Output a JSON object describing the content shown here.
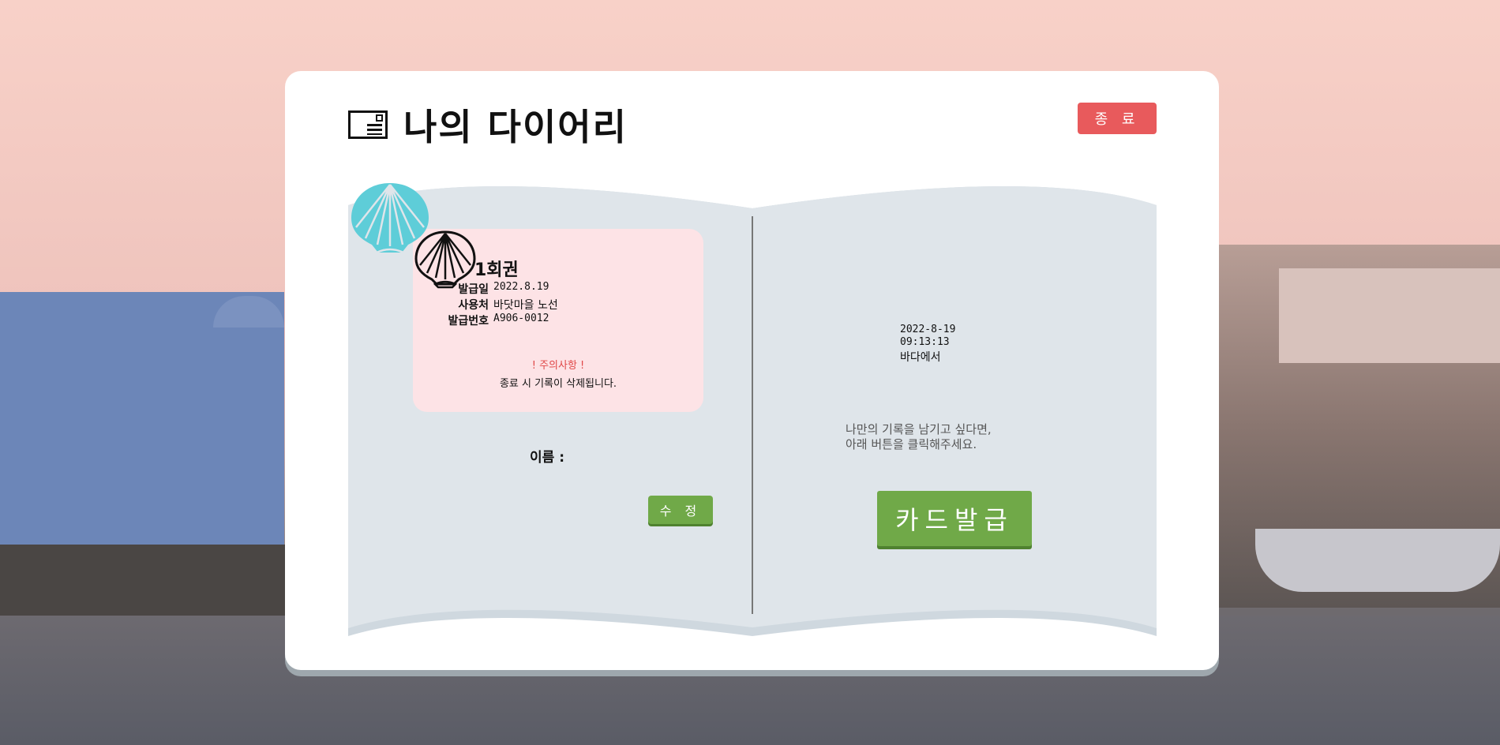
{
  "header": {
    "title": "나의 다이어리",
    "close_label": "종 료"
  },
  "ticket": {
    "title": "1회권",
    "rows": [
      {
        "key": "발급일",
        "value": "2022.8.19"
      },
      {
        "key": "사용처",
        "value": "바닷마을 노선"
      },
      {
        "key": "발급번호",
        "value": "A906-0012"
      }
    ],
    "caution_title": "! 주의사항 !",
    "caution_text": "종료 시 기록이 삭제됩니다."
  },
  "name_label": "이름 :",
  "edit_label": "수 정",
  "entry": {
    "date": "2022-8-19",
    "time": "09:13:13",
    "place": "바다에서"
  },
  "prompt": {
    "line1": "나만의 기록을 남기고 싶다면,",
    "line2": "아래 버튼을 클릭해주세요."
  },
  "issue_label": "카드발급",
  "colors": {
    "close": "#e85a5c",
    "ticket_bg": "#fde3e6",
    "caution": "#e04848",
    "book_page": "#dfe5ea",
    "button_green": "#70a948",
    "shell_teal": "#5ecdd8"
  },
  "icons": {
    "title": "postcard-icon",
    "ticket": "shell-outline-icon",
    "entry": "shell-filled-icon"
  }
}
